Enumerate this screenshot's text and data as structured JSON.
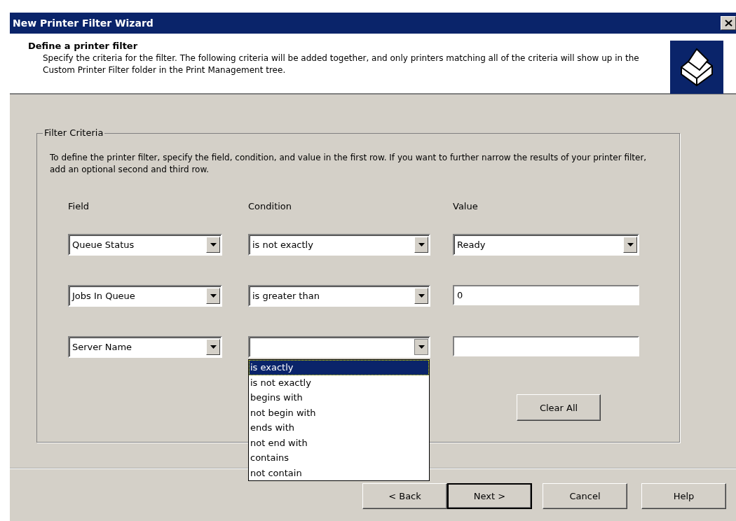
{
  "window": {
    "title": "New Printer Filter Wizard"
  },
  "header": {
    "title": "Define a printer filter",
    "description": "Specify the criteria for the filter. The following criteria will be added together, and only printers matching all of the criteria will show up in the Custom Printer Filter folder in the Print Management tree."
  },
  "group": {
    "label": "Filter Criteria",
    "instructions": "To define the printer filter, specify the field, condition, and value in the first row. If you want to further narrow the results of your printer filter, add an optional second and third row.",
    "columns": [
      "Field",
      "Condition",
      "Value"
    ],
    "rows": [
      {
        "field": {
          "kind": "dropdown",
          "value": "Queue Status"
        },
        "condition": {
          "kind": "dropdown",
          "value": "is not exactly"
        },
        "value": {
          "kind": "dropdown",
          "value": "Ready"
        }
      },
      {
        "field": {
          "kind": "dropdown",
          "value": "Jobs In Queue"
        },
        "condition": {
          "kind": "dropdown",
          "value": "is greater than"
        },
        "value": {
          "kind": "text",
          "value": "0"
        }
      },
      {
        "field": {
          "kind": "dropdown",
          "value": "Server Name"
        },
        "condition": {
          "kind": "dropdown",
          "expanded": true,
          "options": [
            {
              "label": "is exactly",
              "selected": true
            },
            {
              "label": "is not exactly",
              "selected": false
            },
            {
              "label": "begins with",
              "selected": false
            },
            {
              "label": "not begin with",
              "selected": false
            },
            {
              "label": "ends with",
              "selected": false
            },
            {
              "label": "not end with",
              "selected": false
            },
            {
              "label": "contains",
              "selected": false
            },
            {
              "label": "not contain",
              "selected": false
            }
          ]
        },
        "value": {
          "kind": "text"
        }
      }
    ],
    "clear_button": "Clear All"
  },
  "buttons": [
    {
      "label": "< Back",
      "default": false
    },
    {
      "label": "Next >",
      "default": true
    },
    {
      "label": "Cancel",
      "default": false
    },
    {
      "label": "Help",
      "default": false
    }
  ]
}
